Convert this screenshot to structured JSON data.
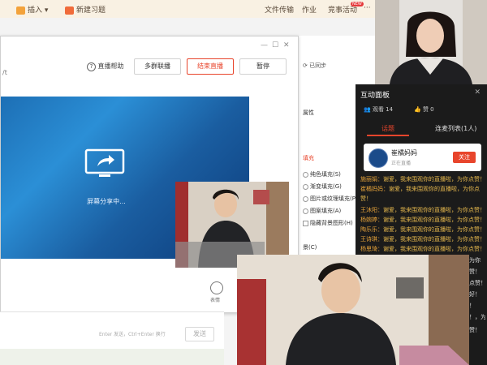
{
  "toolbar": {
    "insert_label": "插入",
    "new_lesson_label": "新建习题",
    "file_transfer_label": "文件传输",
    "homework_label": "作业",
    "activity_label": "竞事活动",
    "activity_badge": "NEW",
    "more_label": "···"
  },
  "secondbar": {
    "sync_label": "已同步"
  },
  "live_window": {
    "path_text": "/t",
    "help_label": "直播帮助",
    "multi_connect_label": "多群联播",
    "end_live_label": "结束直播",
    "pause_label": "暂停",
    "screen_share_text": "屏幕分享中...",
    "emoji_label": "表情"
  },
  "chat_input": {
    "hint": "Enter 发送，Ctrl+Enter 换行",
    "send_label": "发送"
  },
  "doc_panel": {
    "attr_label": "属性",
    "fill_label": "填充",
    "options": [
      "纯色填充(S)",
      "渐变填充(G)",
      "图片或纹理填充(P)",
      "图案填充(A)",
      "隐藏背景图形(H)"
    ],
    "reset_label": "景(C)"
  },
  "interaction_panel": {
    "title": "互动面板",
    "viewers_label": "观看 14",
    "likes_label": "赞 0",
    "tab_chat": "话题",
    "tab_members": "连麦列表(1人)",
    "anchor_name": "崔橘妈妈",
    "anchor_subtitle": "正在直播",
    "follow_label": "关注",
    "messages": [
      {
        "name": "施丽娟：",
        "text": "谢爱，我来围观你的直播啦，为你点赞！"
      },
      {
        "name": "崔橘妈妈：",
        "text": "谢爱，我来围观你的直播啦，为你点"
      },
      {
        "name": "",
        "text": "赞！"
      },
      {
        "name": "王沐阳：",
        "text": "谢爱，我来围观你的直播啦，为你点赞！"
      },
      {
        "name": "杨婉婷：",
        "text": "谢爱，我来围观你的直播啦，为你点赞！"
      },
      {
        "name": "陶乐乐：",
        "text": "谢爱，我来围观你的直播啦，为你点赞！"
      },
      {
        "name": "王诗琪：",
        "text": "谢爱，我来围观你的直播啦，为你点赞！"
      },
      {
        "name": "杨思琦：",
        "text": "谢爱，我来围观你的直播啦，为你点赞！"
      }
    ],
    "partial_lines": [
      "为你",
      "赞！",
      "点赞！",
      "好！",
      "！",
      "！，为",
      "赞！"
    ]
  },
  "colors": {
    "accent_red": "#e8452c",
    "chat_name": "#e8a43a",
    "chat_text": "#e6b84d",
    "panel_bg": "#1b1b1b"
  }
}
